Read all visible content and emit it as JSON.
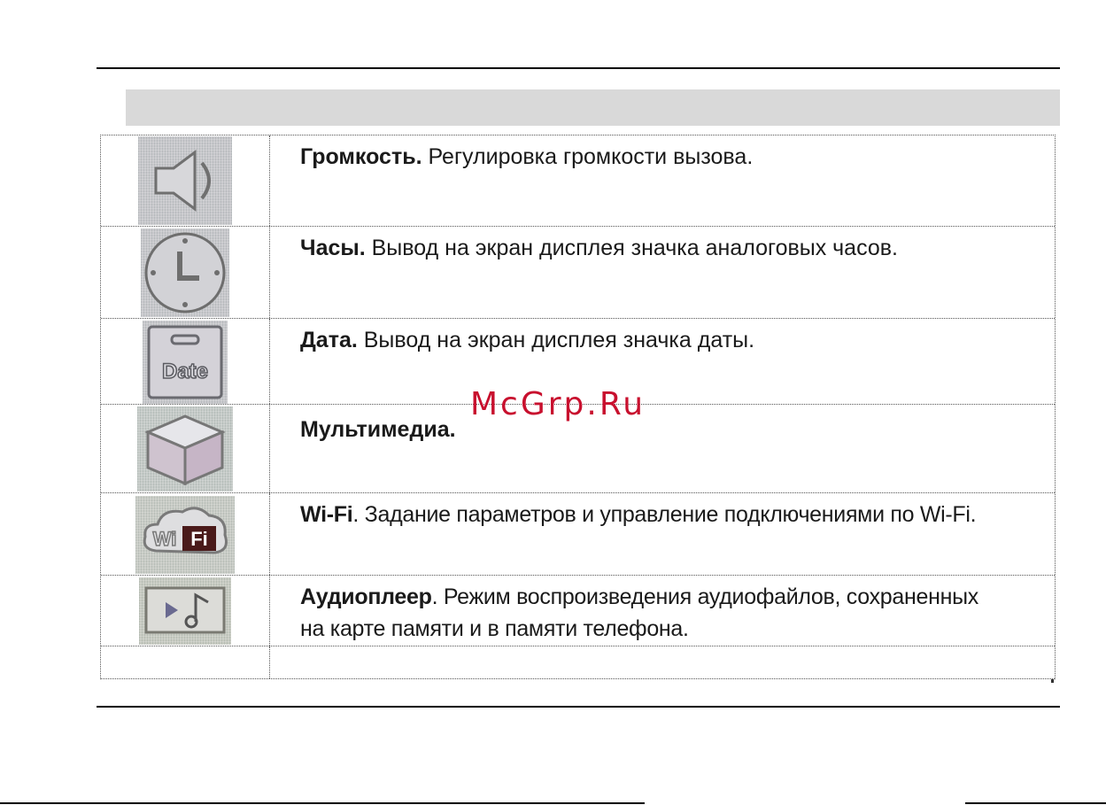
{
  "menu_items": [
    {
      "icon": "speaker-icon",
      "title": "Громкость.",
      "desc": " Регулировка громкости вызова."
    },
    {
      "icon": "clock-icon",
      "title": "Часы.",
      "desc": " Вывод на экран дисплея значка аналоговых часов."
    },
    {
      "icon": "date-icon",
      "title": "Дата.",
      "desc": " Вывод на экран дисплея значка даты.",
      "icon_text": "Date"
    },
    {
      "icon": "cube-icon",
      "title": "Мультимедиа.",
      "desc": ""
    },
    {
      "icon": "wifi-icon",
      "title": "Wi-Fi",
      "desc": ". Задание параметров и управление  подключениями по Wi-Fi.",
      "icon_text_a": "Wi",
      "icon_text_b": "Fi"
    },
    {
      "icon": "music-player-icon",
      "title": "Аудиоплеер",
      "desc": ". Режим воспроизведения аудиофайлов, сохраненных",
      "desc_line2": "на карте памяти и в памяти телефона."
    }
  ],
  "watermark": "McGrp.Ru"
}
